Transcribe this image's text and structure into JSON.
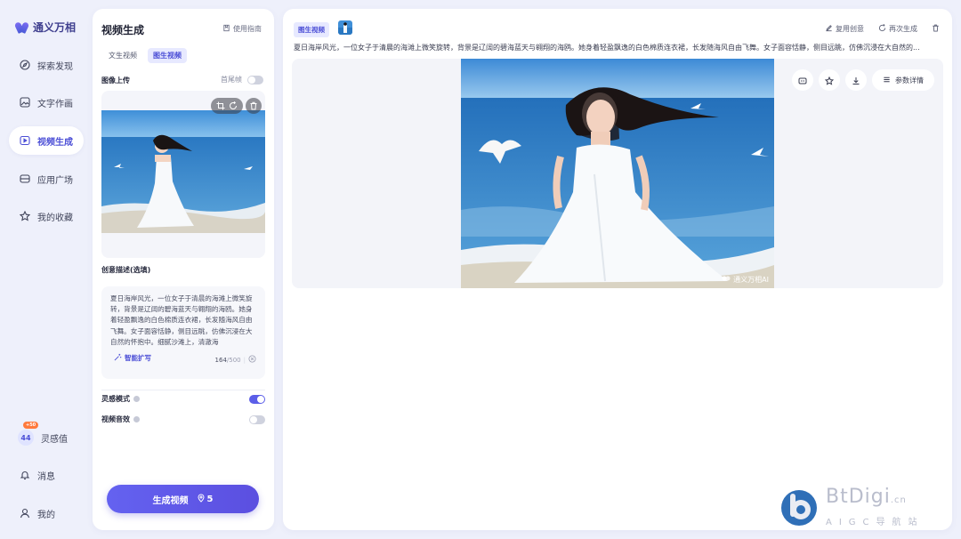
{
  "app": {
    "name": "通义万相"
  },
  "nav": {
    "items": [
      {
        "label": "探索发现",
        "icon": "compass-icon",
        "active": false
      },
      {
        "label": "文字作画",
        "icon": "image-icon",
        "active": false
      },
      {
        "label": "视频生成",
        "icon": "play-icon",
        "active": true
      },
      {
        "label": "应用广场",
        "icon": "app-icon",
        "active": false
      },
      {
        "label": "我的收藏",
        "icon": "star-icon",
        "active": false
      }
    ],
    "credits": {
      "value": "44",
      "badge": "+50",
      "label": "灵感值"
    },
    "messages": "消息",
    "profile": "我的"
  },
  "panel": {
    "title": "视频生成",
    "guide": "使用指南",
    "tabs": [
      {
        "label": "文生视频",
        "active": false
      },
      {
        "label": "图生视频",
        "active": true
      }
    ],
    "upload_label": "图像上传",
    "first_last_frame": "首尾帧",
    "desc_label": "创意描述(选填)",
    "description": "夏日海岸风光，一位女子于清晨的海滩上微笑旋转，背景是辽阔的碧海蓝天与翱翔的海鸥。她身着轻盈飘逸的白色棉质连衣裙，长发随海风自由飞舞。女子面容恬静，侧目远眺，仿佛沉浸在大自然的怀抱中。细腻沙滩上，清澈海",
    "smart_expand": "智能扩写",
    "count_current": "164",
    "count_max": "/500",
    "inspiration_mode": "灵感模式",
    "video_sound": "视频音效",
    "inspiration_on": true,
    "sound_on": false,
    "generate_label": "生成视频",
    "generate_cost": "5"
  },
  "result": {
    "type_badge": "图生视频",
    "reuse": "复用创意",
    "regenerate": "再次生成",
    "prompt": "夏日海岸风光，一位女子于清晨的海滩上微笑旋转，背景是辽阔的碧海蓝天与翱翔的海鸥。她身着轻盈飘逸的白色棉质连衣裙，长发随海风自由飞舞。女子面容恬静，侧目远眺，仿佛沉浸在大自然的...",
    "params": "参数详情",
    "watermark": "通义万相AI"
  },
  "site_mark": {
    "name": "BtDigi",
    "tld": ".cn",
    "sub": "AIGC导航站"
  },
  "colors": {
    "accent": "#5b5ee8",
    "bg": "#eef0fb",
    "badge": "#ff7a3c"
  }
}
